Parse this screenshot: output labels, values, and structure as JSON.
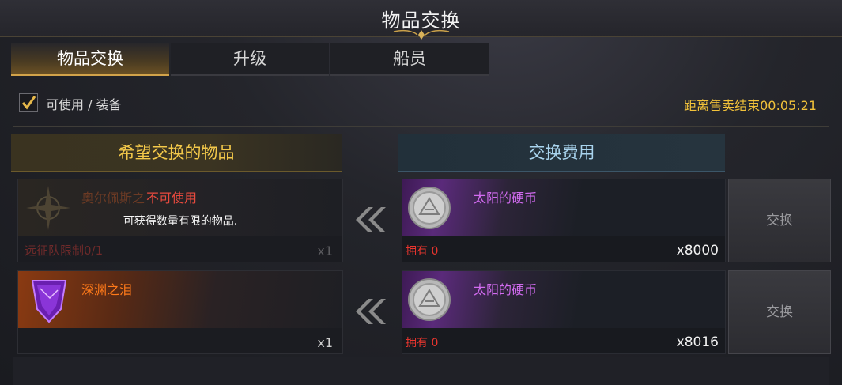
{
  "window": {
    "title": "物品交换"
  },
  "tabs": [
    {
      "label": "物品交换",
      "active": true
    },
    {
      "label": "升级",
      "active": false
    },
    {
      "label": "船员",
      "active": false
    }
  ],
  "filter": {
    "label": "可使用 / 装备",
    "checked": true
  },
  "timer": "距离售卖结束00:05:21",
  "headers": {
    "wanted": "希望交换的物品",
    "cost": "交换费用"
  },
  "rows": [
    {
      "item": {
        "name": "奥尔佩斯之",
        "icon": "compass-star-icon",
        "unusable_label": "不可使用",
        "message": "可获得数量有限的物品.",
        "limit": "远征队限制0/1",
        "qty": "x1"
      },
      "cost": {
        "name": "太阳的硬币",
        "icon": "sun-coin-icon",
        "owned": "拥有 0",
        "amount": "x8000"
      },
      "button": "交换"
    },
    {
      "item": {
        "name": "深渊之泪",
        "icon": "purple-gem-icon",
        "qty": "x1"
      },
      "cost": {
        "name": "太阳的硬币",
        "icon": "sun-coin-icon",
        "owned": "拥有 0",
        "amount": "x8016"
      },
      "button": "交换"
    }
  ],
  "colors": {
    "accent_gold": "#f4c94a",
    "timer": "#f2c23a",
    "unusable": "#e84a3e",
    "coin_name": "#d26bf0",
    "gem_name": "#ff7a1a",
    "cost_header": "#a9d4ee"
  }
}
